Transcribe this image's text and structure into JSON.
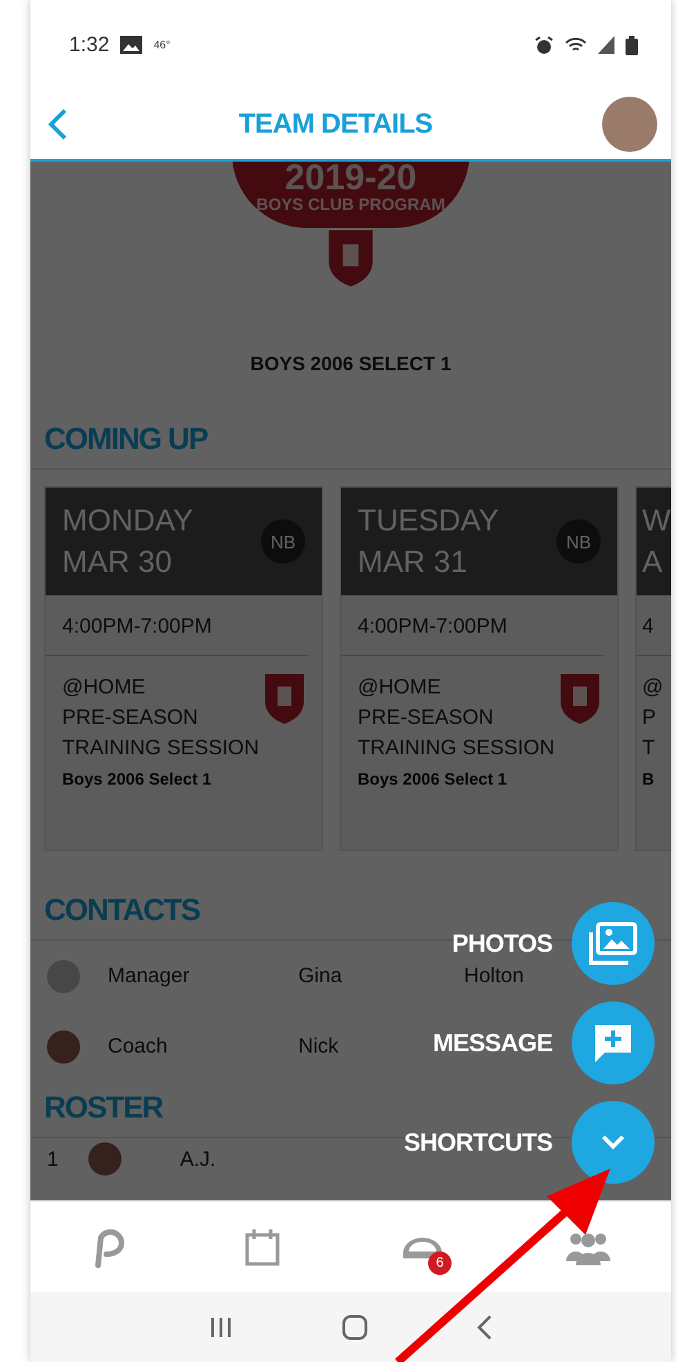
{
  "status_bar": {
    "time": "1:32",
    "temperature": "46°"
  },
  "header": {
    "title": "TEAM DETAILS"
  },
  "team": {
    "logo_year": "2019-20",
    "logo_caption": "BOYS CLUB PROGRAM",
    "name": "BOYS 2006 SELECT 1"
  },
  "coming_up": {
    "heading": "COMING UP",
    "events": [
      {
        "day": "MONDAY",
        "date": "MAR 30",
        "initials": "NB",
        "time": "4:00PM-7:00PM",
        "location": "@HOME",
        "title_lines": [
          "PRE-SEASON",
          "TRAINING SESSION"
        ],
        "team": "Boys 2006 Select 1"
      },
      {
        "day": "TUESDAY",
        "date": "MAR 31",
        "initials": "NB",
        "time": "4:00PM-7:00PM",
        "location": "@HOME",
        "title_lines": [
          "PRE-SEASON",
          "TRAINING SESSION"
        ],
        "team": "Boys 2006 Select 1"
      },
      {
        "day": "W",
        "date": "A",
        "time": "4",
        "location": "@",
        "title_lines": [
          "P",
          "T"
        ],
        "team": "B"
      }
    ]
  },
  "contacts": {
    "heading": "CONTACTS",
    "items": [
      {
        "role": "Manager",
        "first": "Gina",
        "last": "Holton",
        "photo": false
      },
      {
        "role": "Coach",
        "first": "Nick",
        "photo": true
      }
    ]
  },
  "roster": {
    "heading": "ROSTER",
    "items": [
      {
        "number": "1",
        "first": "A.J."
      }
    ]
  },
  "shortcuts_menu": {
    "expanded": true,
    "toggle_label": "SHORTCUTS",
    "items": [
      {
        "kind": "photos",
        "label": "PHOTOS"
      },
      {
        "kind": "message",
        "label": "MESSAGE"
      }
    ]
  },
  "bottom_nav": [
    {
      "kind": "home"
    },
    {
      "kind": "calendar"
    },
    {
      "kind": "chat",
      "badge": "6"
    },
    {
      "kind": "team"
    }
  ],
  "annotation": {
    "kind": "arrow"
  }
}
